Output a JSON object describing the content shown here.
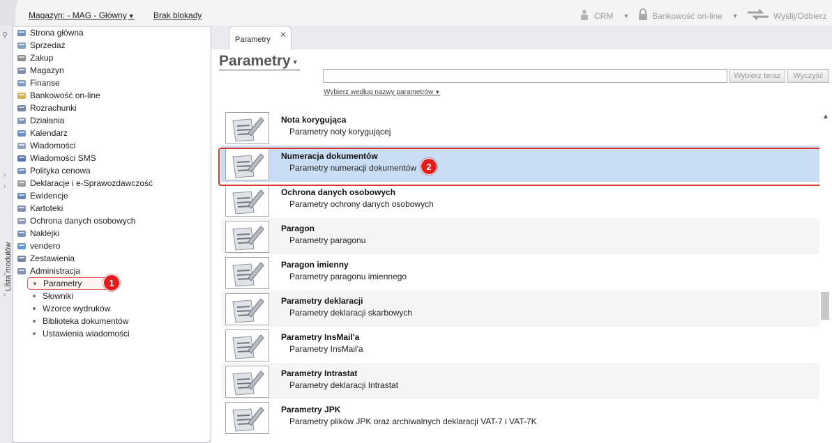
{
  "topbar": {
    "warehouse_label": "Magazyn: - MAG - Główny",
    "lock_status": "Brak blokady",
    "crm_label": "CRM",
    "banking_label": "Bankowość on-line",
    "send_receive_label": "Wyślij/Odbierz"
  },
  "sidebar": {
    "vertical_label": "Lista modułów",
    "items": [
      {
        "label": "Strona główna",
        "icon": "home-icon"
      },
      {
        "label": "Sprzedaż",
        "icon": "sales-icon"
      },
      {
        "label": "Zakup",
        "icon": "purchase-icon"
      },
      {
        "label": "Magazyn",
        "icon": "warehouse-icon"
      },
      {
        "label": "Finanse",
        "icon": "finance-icon"
      },
      {
        "label": "Bankowość on-line",
        "icon": "bank-icon"
      },
      {
        "label": "Rozrachunki",
        "icon": "settlements-icon"
      },
      {
        "label": "Działania",
        "icon": "actions-icon"
      },
      {
        "label": "Kalendarz",
        "icon": "calendar-icon"
      },
      {
        "label": "Wiadomości",
        "icon": "messages-icon"
      },
      {
        "label": "Wiadomości SMS",
        "icon": "sms-icon"
      },
      {
        "label": "Polityka cenowa",
        "icon": "pricing-icon"
      },
      {
        "label": "Deklaracje i e-Sprawozdawczość",
        "icon": "declarations-icon"
      },
      {
        "label": "Ewidencje",
        "icon": "records-icon"
      },
      {
        "label": "Kartoteki",
        "icon": "files-icon"
      },
      {
        "label": "Ochrona danych osobowych",
        "icon": "shield-icon"
      },
      {
        "label": "Naklejki",
        "icon": "stickers-icon"
      },
      {
        "label": "vendero",
        "icon": "vendero-icon"
      },
      {
        "label": "Zestawienia",
        "icon": "reports-icon"
      },
      {
        "label": "Administracja",
        "icon": "admin-icon"
      }
    ],
    "sub_items": [
      {
        "label": "Parametry"
      },
      {
        "label": "Słowniki"
      },
      {
        "label": "Wzorce wydruków"
      },
      {
        "label": "Biblioteka dokumentów"
      },
      {
        "label": "Ustawienia wiadomości"
      }
    ],
    "badge_1": "1"
  },
  "main": {
    "tab_label": "Parametry",
    "title": "Parametry",
    "search_value": "",
    "choose_now_label": "Wybierz teraz",
    "clear_label": "Wyczyść",
    "filter_label": "Wybierz według nazwy parametrów",
    "badge_2": "2",
    "rows": [
      {
        "title": "Nota korygująca",
        "desc": "Parametry noty korygującej"
      },
      {
        "title": "Numeracja dokumentów",
        "desc": "Parametry numeracji dokumentów"
      },
      {
        "title": "Ochrona danych osobowych",
        "desc": "Parametry ochrony danych osobowych"
      },
      {
        "title": "Paragon",
        "desc": "Parametry paragonu"
      },
      {
        "title": "Paragon imienny",
        "desc": "Parametry paragonu imiennego"
      },
      {
        "title": "Parametry deklaracji",
        "desc": "Parametry deklaracji skarbowych"
      },
      {
        "title": "Parametry InsMail'a",
        "desc": "Parametry InsMail'a"
      },
      {
        "title": "Parametry Intrastat",
        "desc": "Parametry deklaracji Intrastat"
      },
      {
        "title": "Parametry JPK",
        "desc": "Parametry plików JPK oraz archiwalnych deklaracji VAT-7 i VAT-7K"
      }
    ],
    "selected_index": 1
  },
  "colors": {
    "selected_row": "#c9def5",
    "highlight_red": "#d9362f",
    "badge_red": "#e21b1b"
  }
}
